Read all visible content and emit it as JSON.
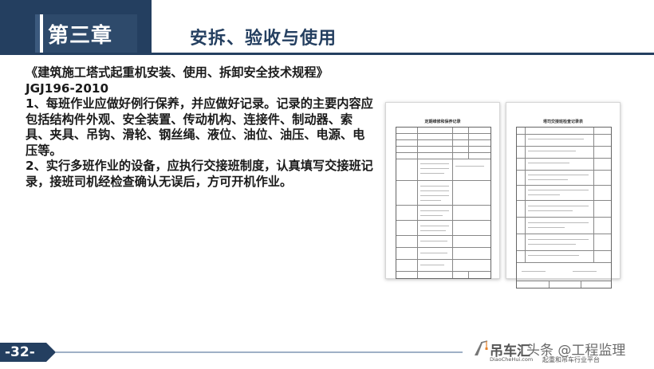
{
  "header": {
    "chapter": "第三章",
    "title": "安拆、验收与使用"
  },
  "body": {
    "paragraphs": [
      "《建筑施工塔式起重机安装、使用、拆卸安全技术规程》JGJ196-2010",
      "1、每班作业应做好例行保养，并应做好记录。记录的主要内容应包括结构件外观、安全装置、传动机构、连接件、制动器、索具、夹具、吊钩、滑轮、钢丝绳、液位、油位、油压、电源、电压等。",
      "2、实行多班作业的设备，应执行交接班制度，认真填写交接班记录，接班司机经检查确认无误后，方可开机作业。"
    ]
  },
  "documents": {
    "left_title": "定期维修和保养记录",
    "right_title": "塔司交接班检查记录表"
  },
  "footer": {
    "page": "-32-"
  },
  "watermark": {
    "brand": "吊车汇",
    "url": "DiaoCheHui.com",
    "slogan": "起重和吊车行业平台",
    "account": "头条 @工程监理"
  },
  "colors": {
    "primary": "#243f60",
    "text": "#1a1a1a"
  }
}
